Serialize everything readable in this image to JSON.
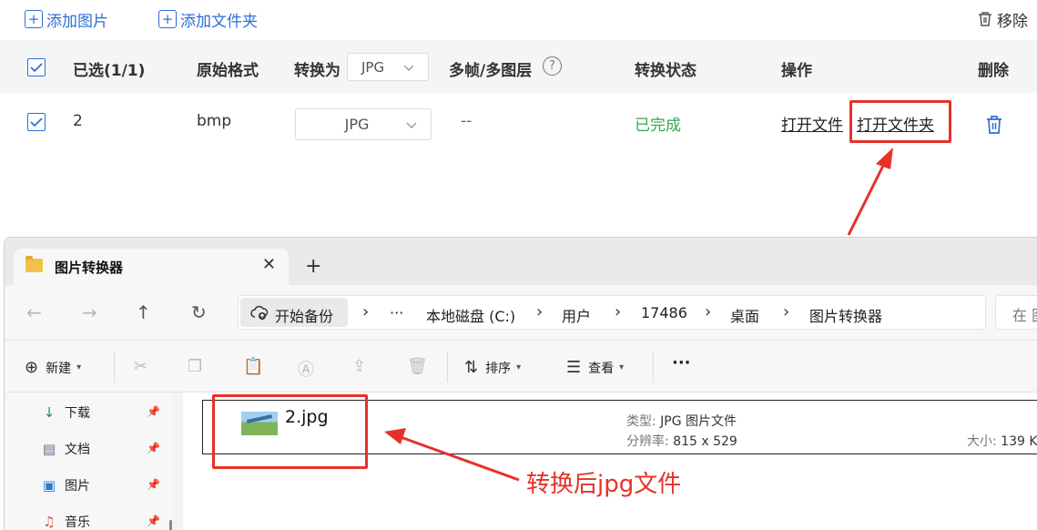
{
  "toolbar": {
    "add_image": "添加图片",
    "add_folder": "添加文件夹",
    "remove": "移除"
  },
  "table": {
    "headers": {
      "selected": "已选(1/1)",
      "original_format": "原始格式",
      "convert_to": "转换为",
      "convert_to_value": "JPG",
      "multiframe": "多帧/多图层",
      "status": "转换状态",
      "actions": "操作",
      "delete": "删除"
    },
    "rows": [
      {
        "name": "2",
        "format": "bmp",
        "target": "JPG",
        "multiframe": "--",
        "status": "已完成",
        "open_file": "打开文件",
        "open_folder": "打开文件夹"
      }
    ]
  },
  "explorer": {
    "tab_title": "图片转换器",
    "breadcrumb": {
      "backup": "开始备份",
      "ellipsis": "···",
      "drive": "本地磁盘 (C:)",
      "users": "用户",
      "user": "17486",
      "desktop": "桌面",
      "folder": "图片转换器"
    },
    "search_placeholder": "在 图",
    "commands": {
      "new": "新建",
      "sort": "排序",
      "view": "查看",
      "more": "···"
    },
    "sidebar": [
      {
        "label": "下载",
        "icon": "download-icon"
      },
      {
        "label": "文档",
        "icon": "document-icon"
      },
      {
        "label": "图片",
        "icon": "pictures-icon"
      },
      {
        "label": "音乐",
        "icon": "music-icon"
      }
    ],
    "file": {
      "name": "2.jpg",
      "type_key": "类型:",
      "type_value": "JPG 图片文件",
      "res_key": "分辨率:",
      "res_value": "815 x 529",
      "size_key": "大小:",
      "size_value": "139 K"
    }
  },
  "annotation": "转换后jpg文件",
  "colors": {
    "accent": "#2f6fd6",
    "success": "#33a852",
    "annotation": "#e8302a"
  }
}
